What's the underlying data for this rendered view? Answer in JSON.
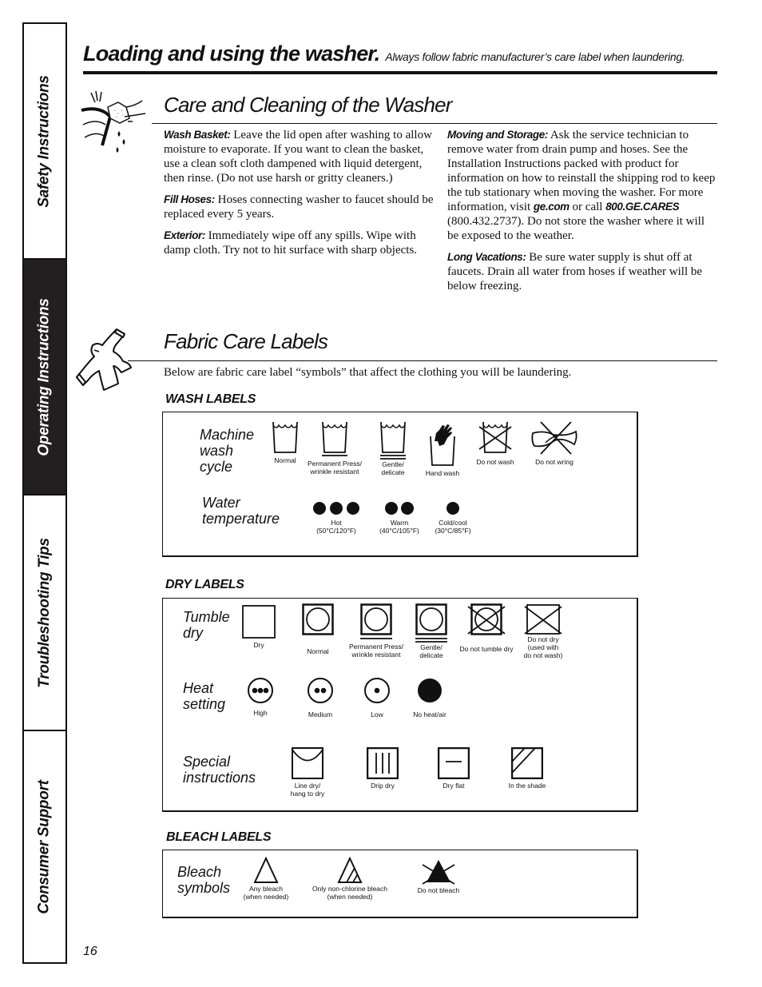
{
  "sidebar": {
    "tabs": [
      {
        "label": "Safety Instructions",
        "active": false
      },
      {
        "label": "Operating Instructions",
        "active": true
      },
      {
        "label": "Troubleshooting Tips",
        "active": false
      },
      {
        "label": "Consumer Support",
        "active": false
      }
    ]
  },
  "header": {
    "title": "Loading and using the washer.",
    "subtitle": "Always follow fabric manufacturer’s care label when laundering."
  },
  "care": {
    "title": "Care and Cleaning of the Washer",
    "icon": "sponge-cleaning-icon",
    "left": [
      {
        "lead": "Wash Basket:",
        "text": " Leave the lid open after washing to allow moisture to evaporate. If you want to clean the basket, use a clean soft cloth dampened with liquid detergent, then rinse. (Do not use harsh or gritty cleaners.)"
      },
      {
        "lead": "Fill Hoses:",
        "text": " Hoses connecting washer to faucet should be replaced every 5 years."
      },
      {
        "lead": "Exterior:",
        "text": " Immediately wipe off any spills. Wipe with damp cloth. Try not to hit surface with sharp objects."
      }
    ],
    "right": {
      "moving": {
        "lead": "Moving and Storage:",
        "text1": " Ask the service technician to remove water from drain pump and hoses. See the Installation Instructions packed with product for information on how to reinstall the shipping rod to keep the tub stationary when moving the washer. For more information, visit ",
        "link1": "ge.com",
        "text2": " or call ",
        "link2": "800.GE.CARES",
        "text3": " (800.432.2737). Do not store the washer where it will be exposed to the weather."
      },
      "vacation": {
        "lead": "Long Vacations:",
        "text": " Be sure water supply is shut off at faucets. Drain all water from hoses if weather will be below freezing."
      }
    }
  },
  "fabric": {
    "title": "Fabric Care Labels",
    "icon": "shirt-icon",
    "intro": "Below are fabric care label “symbols” that affect the clothing you will be laundering."
  },
  "wash": {
    "heading": "WASH LABELS",
    "cycle_label": "Machine\nwash\ncycle",
    "cycle": [
      {
        "icon": "washtub-normal-icon",
        "caption": "Normal"
      },
      {
        "icon": "washtub-permanent-press-icon",
        "caption": "Permanent Press/\nwrinkle resistant"
      },
      {
        "icon": "washtub-gentle-icon",
        "caption": "Gentle/\ndelicate"
      },
      {
        "icon": "hand-wash-icon",
        "caption": "Hand wash"
      },
      {
        "icon": "do-not-wash-icon",
        "caption": "Do not wash"
      },
      {
        "icon": "do-not-wring-icon",
        "caption": "Do not wring"
      }
    ],
    "temp_label": "Water\ntemperature",
    "temps": [
      {
        "dots": 3,
        "caption": "Hot\n(50°C/120°F)"
      },
      {
        "dots": 2,
        "caption": "Warm\n(40°C/105°F)"
      },
      {
        "dots": 1,
        "caption": "Cold/cool\n(30°C/85°F)"
      }
    ]
  },
  "dry": {
    "heading": "DRY LABELS",
    "tumble_label": "Tumble\ndry",
    "tumble": [
      {
        "icon": "dry-square-icon",
        "caption": "Dry"
      },
      {
        "icon": "tumble-normal-icon",
        "caption": "Normal"
      },
      {
        "icon": "tumble-permanent-press-icon",
        "caption": "Permanent Press/\nwrinkle resistant"
      },
      {
        "icon": "tumble-gentle-icon",
        "caption": "Gentle/\ndelicate"
      },
      {
        "icon": "do-not-tumble-dry-icon",
        "caption": "Do not tumble dry"
      },
      {
        "icon": "do-not-dry-icon",
        "caption": "Do not dry\n(used with\ndo not wash)"
      }
    ],
    "heat_label": "Heat\nsetting",
    "heat": [
      {
        "dots": 3,
        "caption": "High"
      },
      {
        "dots": 2,
        "caption": "Medium"
      },
      {
        "dots": 1,
        "caption": "Low"
      },
      {
        "dots": 0,
        "caption": "No heat/air"
      }
    ],
    "special_label": "Special\ninstructions",
    "special": [
      {
        "icon": "line-dry-icon",
        "caption": "Line dry/\nhang to dry"
      },
      {
        "icon": "drip-dry-icon",
        "caption": "Drip dry"
      },
      {
        "icon": "dry-flat-icon",
        "caption": "Dry flat"
      },
      {
        "icon": "dry-in-shade-icon",
        "caption": "In the shade"
      }
    ]
  },
  "bleach": {
    "heading": "BLEACH LABELS",
    "label": "Bleach\nsymbols",
    "items": [
      {
        "icon": "any-bleach-icon",
        "caption": "Any bleach\n(when needed)"
      },
      {
        "icon": "non-chlorine-bleach-icon",
        "caption": "Only non-chlorine bleach\n(when needed)"
      },
      {
        "icon": "do-not-bleach-icon",
        "caption": "Do not bleach"
      }
    ]
  },
  "footer": {
    "page_number": "16"
  }
}
